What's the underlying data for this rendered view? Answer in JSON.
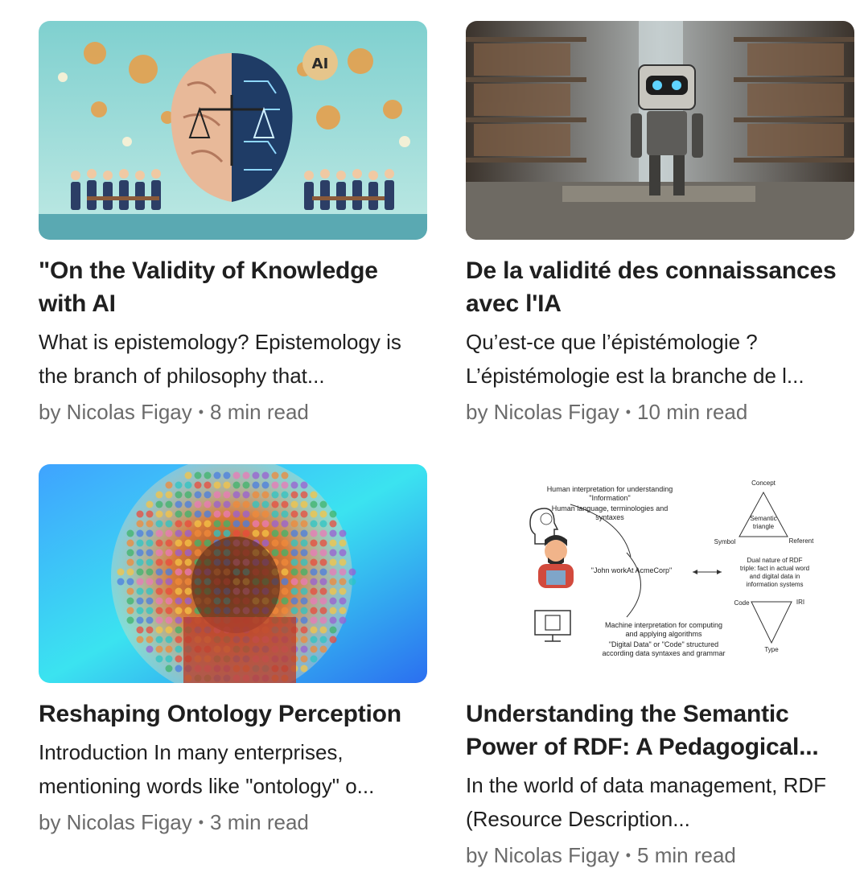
{
  "articles": [
    {
      "title": "\"On the Validity of Knowledge with AI",
      "description": "What is epistemology? Epistemology is the branch of philosophy that...",
      "author": "by Nicolas Figay",
      "read_time": "8 min read",
      "badge": "AI"
    },
    {
      "title": "De la validité des connaissances avec l'IA",
      "description": "Qu’est-ce que l’épistémologie ? L’épistémologie est la branche de l...",
      "author": "by Nicolas Figay",
      "read_time": "10 min read"
    },
    {
      "title": "Reshaping Ontology Perception",
      "description": "Introduction In many enterprises, mentioning words like \"ontology\" o...",
      "author": "by Nicolas Figay",
      "read_time": "3 min read"
    },
    {
      "title": "Understanding the Semantic Power of RDF: A Pedagogical...",
      "description": "In the world of data management, RDF (Resource Description...",
      "author": "by Nicolas Figay",
      "read_time": "5 min read",
      "diagram": {
        "top_text_1": "Human interpretation for understanding",
        "top_text_2": "\"Information\"",
        "top_text_3": "Human language, terminologies and",
        "top_text_4": "syntaxes",
        "center_text": "\"John workAt AcmeCorp\"",
        "bottom_text_1": "Machine interpretation for computing",
        "bottom_text_2": "and applying algorithms",
        "bottom_text_3": "\"Digital Data\" or \"Code\" structured",
        "bottom_text_4": "according data syntaxes and grammar",
        "concept": "Concept",
        "semantic_1": "Semantic",
        "semantic_2": "triangle",
        "symbol": "Symbol",
        "referent": "Referent",
        "dual_1": "Dual nature of RDF",
        "dual_2": "triple: fact in actual word",
        "dual_3": "and digital data in",
        "dual_4": "information systems",
        "code": "Code",
        "iri": "IRI",
        "type": "Type"
      }
    }
  ]
}
